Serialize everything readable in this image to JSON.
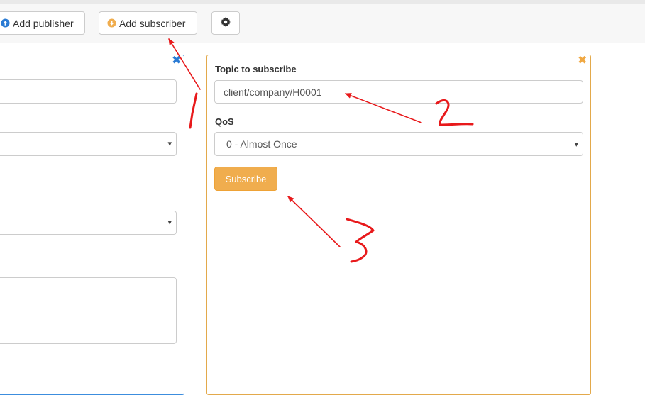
{
  "toolbar": {
    "add_publisher_label": "Add publisher",
    "add_subscriber_label": "Add subscriber"
  },
  "subscriber_panel": {
    "topic_label": "Topic to subscribe",
    "topic_value": "client/company/H0001",
    "qos_label": "QoS",
    "qos_selected": "0 - Almost Once",
    "subscribe_label": "Subscribe"
  },
  "colors": {
    "publisher_border": "#3c8dde",
    "subscriber_border": "#e3a94b",
    "subscribe_button": "#f0ad4e",
    "annotation": "#e8191b"
  },
  "icons": {
    "publisher": "arrow-up-circle-icon",
    "subscriber": "arrow-down-circle-icon",
    "settings": "gear-icon",
    "close": "close-icon"
  }
}
